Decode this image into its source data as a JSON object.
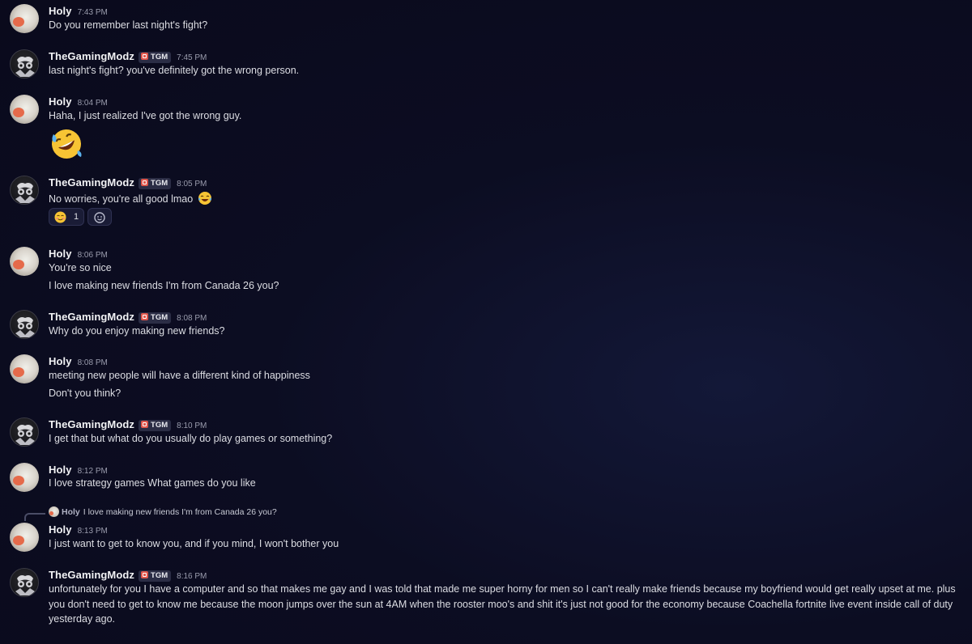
{
  "messages": [
    {
      "user": "Holy",
      "time": "7:43 PM",
      "lines": [
        "Do you remember last night's fight?"
      ]
    },
    {
      "user": "TheGamingModz",
      "tag": "TGM",
      "time": "7:45 PM",
      "lines": [
        "last night's fight? you've definitely got the wrong person."
      ]
    },
    {
      "user": "Holy",
      "time": "8:04 PM",
      "lines": [
        "Haha, I just realized I've got the wrong guy."
      ],
      "emoji": "rolling-on-floor-laughing"
    },
    {
      "user": "TheGamingModz",
      "tag": "TGM",
      "time": "8:05 PM",
      "lines": [
        "No worries, you're all good lmao"
      ],
      "inline_emoji": "tears-of-joy",
      "reactions": [
        {
          "emoji": "smiling-face",
          "count": "1"
        },
        {
          "emoji": "add-reaction-icon"
        }
      ]
    },
    {
      "user": "Holy",
      "time": "8:06 PM",
      "lines": [
        "You're so nice",
        "I love making new friends I'm from Canada 26 you?"
      ]
    },
    {
      "user": "TheGamingModz",
      "tag": "TGM",
      "time": "8:08 PM",
      "lines": [
        "Why do you enjoy making new friends?"
      ]
    },
    {
      "user": "Holy",
      "time": "8:08 PM",
      "lines": [
        "meeting new people will have a different kind of happiness",
        "Don't you think?"
      ]
    },
    {
      "user": "TheGamingModz",
      "tag": "TGM",
      "time": "8:10 PM",
      "lines": [
        "I get that but what do you usually do play games or something?"
      ]
    },
    {
      "user": "Holy",
      "time": "8:12 PM",
      "lines": [
        "I love strategy games What games do you like"
      ]
    },
    {
      "user": "Holy",
      "time": "8:13 PM",
      "reply": {
        "user": "Holy",
        "text": "I love making new friends I'm from Canada 26 you?"
      },
      "lines": [
        "I just want to get to know you, and if you mind, I won't bother you"
      ]
    },
    {
      "user": "TheGamingModz",
      "tag": "TGM",
      "time": "8:16 PM",
      "lines": [
        "unfortunately for you I have a computer and so that makes me gay and I was told that made me super horny for men so I can't really make friends because my boyfriend would get really upset at me. plus you don't need to get to know me because the moon jumps over the sun at 4AM when the rooster moo's and shit it's just not good for the economy because Coachella fortnite live event inside call of duty yesterday ago."
      ]
    }
  ],
  "colors": {
    "background": "#0b0c1f",
    "username": "#f2f3f5",
    "text": "#dcdde3",
    "timestamp": "#9a9cad",
    "tag_bg": "#2b2d45",
    "tag_icon": "#e0564b"
  }
}
